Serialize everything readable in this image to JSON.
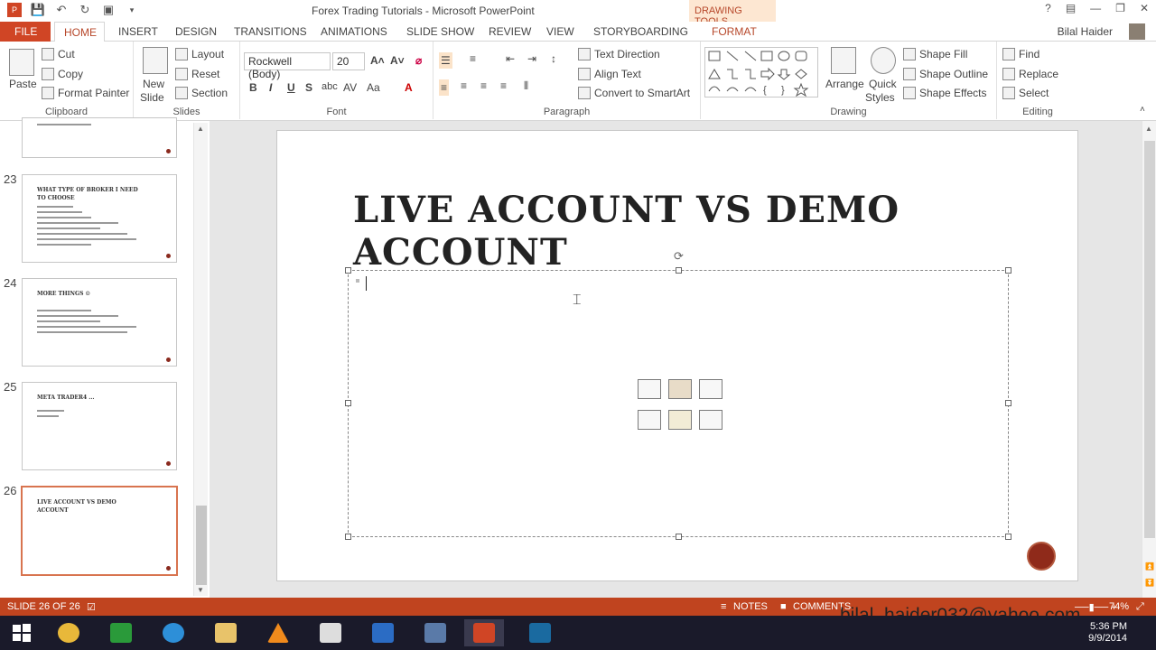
{
  "window": {
    "title": "Forex Trading Tutorials - Microsoft PowerPoint",
    "context_tab_label": "DRAWING TOOLS",
    "user": "Bilal Haider"
  },
  "tabs": [
    "FILE",
    "HOME",
    "INSERT",
    "DESIGN",
    "TRANSITIONS",
    "ANIMATIONS",
    "SLIDE SHOW",
    "REVIEW",
    "VIEW",
    "STORYBOARDING",
    "FORMAT"
  ],
  "ribbon": {
    "clipboard": {
      "paste": "Paste",
      "cut": "Cut",
      "copy": "Copy",
      "format_painter": "Format Painter",
      "label": "Clipboard"
    },
    "slides": {
      "new_slide_1": "New",
      "new_slide_2": "Slide",
      "layout": "Layout",
      "reset": "Reset",
      "section": "Section",
      "label": "Slides"
    },
    "font": {
      "font_name": "Rockwell (Body)",
      "font_size": "20",
      "label": "Font"
    },
    "paragraph": {
      "text_direction": "Text Direction",
      "align_text": "Align Text",
      "convert_smartart": "Convert to SmartArt",
      "label": "Paragraph"
    },
    "drawing": {
      "arrange": "Arrange",
      "quick_styles_1": "Quick",
      "quick_styles_2": "Styles",
      "shape_fill": "Shape Fill",
      "shape_outline": "Shape Outline",
      "shape_effects": "Shape Effects",
      "label": "Drawing"
    },
    "editing": {
      "find": "Find",
      "replace": "Replace",
      "select": "Select",
      "label": "Editing"
    }
  },
  "thumbnails": [
    {
      "num": "23",
      "title": "WHAT TYPE OF BROKER I NEED TO CHOOSE"
    },
    {
      "num": "24",
      "title": "MORE THINGS ☺"
    },
    {
      "num": "25",
      "title": "META TRADER4 ..."
    },
    {
      "num": "26",
      "title": "LIVE ACCOUNT VS DEMO ACCOUNT"
    }
  ],
  "slide": {
    "title": "LIVE ACCOUNT VS DEMO ACCOUNT"
  },
  "statusbar": {
    "slide_info": "SLIDE 26 OF 26",
    "notes": "NOTES",
    "comments": "COMMENTS",
    "zoom": "74%"
  },
  "watermark": "bilal_haider032@yahoo.com",
  "clock": {
    "time": "5:36 PM",
    "date": "9/9/2014"
  },
  "colors": {
    "accent": "#c0441f",
    "file_tab": "#d04525"
  }
}
